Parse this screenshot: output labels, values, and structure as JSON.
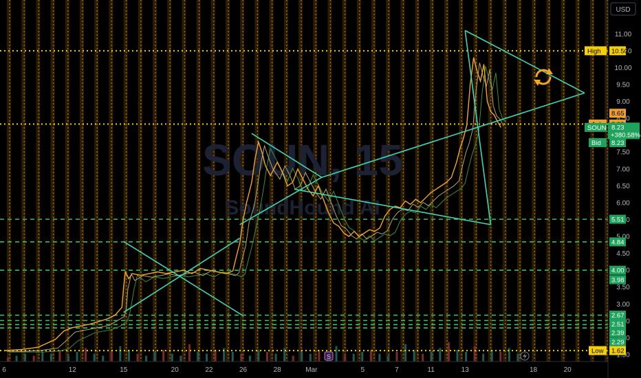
{
  "chart_data": {
    "type": "line",
    "title": "",
    "watermark": {
      "symbol": "SOUN",
      "interval": "15",
      "company": "SoundHound AI"
    },
    "currency": "USD",
    "ylim": [
      1.5,
      11.8
    ],
    "y_ticks": [
      1.5,
      2.0,
      2.5,
      3.0,
      3.5,
      4.0,
      4.5,
      5.0,
      5.5,
      6.0,
      6.5,
      7.0,
      7.5,
      8.0,
      8.5,
      9.0,
      9.5,
      10.0,
      10.5,
      11.0
    ],
    "x_ticks": [
      {
        "label": "6",
        "pos": 0
      },
      {
        "label": "12",
        "pos": 4
      },
      {
        "label": "15",
        "pos": 7
      },
      {
        "label": "20",
        "pos": 10
      },
      {
        "label": "22",
        "pos": 12
      },
      {
        "label": "26",
        "pos": 14
      },
      {
        "label": "28",
        "pos": 16
      },
      {
        "label": "Mar",
        "pos": 18
      },
      {
        "label": "5",
        "pos": 21
      },
      {
        "label": "7",
        "pos": 23
      },
      {
        "label": "11",
        "pos": 25
      },
      {
        "label": "13",
        "pos": 27
      },
      {
        "label": "18",
        "pos": 31
      },
      {
        "label": "20",
        "pos": 33
      }
    ],
    "xlim": [
      0,
      34
    ],
    "series": [
      {
        "name": "SOUN",
        "color": "#f5a623",
        "x": [
          0,
          1,
          2,
          3,
          3.5,
          4,
          5,
          6,
          6.5,
          6.9,
          7,
          7.1,
          7.3,
          7.5,
          8,
          8.5,
          9,
          9.5,
          10,
          10.5,
          11,
          11.5,
          12,
          12.5,
          13,
          13.4,
          13.6,
          13.8,
          14,
          14.2,
          14.5,
          14.7,
          14.9,
          15.1,
          15.3,
          15.6,
          16,
          16.3,
          16.6,
          16.9,
          17.2,
          17.5,
          17.8,
          18.1,
          18.4,
          18.7,
          19,
          19.3,
          19.6,
          19.9,
          20.2,
          20.5,
          20.8,
          21.1,
          21.4,
          21.7,
          22,
          22.3,
          22.6,
          22.9,
          23.2,
          23.5,
          23.8,
          24.1,
          24.4,
          24.7,
          25,
          25.3,
          25.6,
          25.9,
          26.2,
          26.5,
          26.7,
          26.9,
          27.1,
          27.3,
          27.5,
          27.7,
          27.9,
          28.1,
          28.3,
          28.5,
          28.7,
          28.9,
          29.1
        ],
        "y": [
          1.62,
          1.65,
          1.72,
          1.95,
          2.2,
          2.3,
          2.4,
          2.55,
          2.67,
          2.9,
          3.5,
          3.95,
          3.75,
          3.9,
          3.85,
          3.9,
          3.95,
          3.9,
          3.95,
          4.0,
          3.9,
          4.05,
          4.0,
          3.95,
          3.9,
          3.98,
          4.4,
          4.8,
          5.5,
          6.0,
          6.6,
          7.3,
          7.8,
          7.5,
          7.1,
          6.8,
          7.2,
          6.9,
          6.5,
          6.6,
          7.0,
          6.7,
          6.4,
          6.2,
          6.5,
          6.1,
          5.7,
          5.4,
          5.3,
          5.1,
          5.0,
          5.15,
          5.0,
          5.1,
          5.2,
          5.15,
          5.25,
          5.6,
          5.8,
          5.9,
          5.85,
          6.05,
          5.95,
          6.1,
          6.0,
          6.15,
          6.3,
          6.4,
          6.5,
          6.6,
          6.75,
          7.2,
          7.6,
          7.9,
          8.3,
          9.5,
          10.3,
          9.9,
          9.6,
          10.1,
          9.0,
          8.7,
          8.6,
          8.4,
          8.23
        ]
      }
    ],
    "trend_lines": [
      {
        "x1": 7.0,
        "y1": 2.75,
        "x2": 13.8,
        "y2": 4.95
      },
      {
        "x1": 7.0,
        "y1": 4.85,
        "x2": 14.0,
        "y2": 2.65
      },
      {
        "x1": 13.8,
        "y1": 5.35,
        "x2": 18.6,
        "y2": 6.75
      },
      {
        "x1": 14.5,
        "y1": 8.05,
        "x2": 18.6,
        "y2": 6.75
      },
      {
        "x1": 18.6,
        "y1": 6.75,
        "x2": 34.0,
        "y2": 9.25
      },
      {
        "x1": 17.0,
        "y1": 6.4,
        "x2": 28.5,
        "y2": 5.35
      },
      {
        "x1": 28.5,
        "y1": 5.35,
        "x2": 27.0,
        "y2": 11.1
      },
      {
        "x1": 27.0,
        "y1": 11.1,
        "x2": 34.0,
        "y2": 9.25
      }
    ],
    "yellow_levels": [
      10.5,
      8.33,
      1.62
    ],
    "green_levels": [
      5.51,
      4.84,
      4.0,
      2.67,
      2.51,
      2.39,
      2.29
    ],
    "price_labels": [
      {
        "text": "High",
        "value": "10.50",
        "y": 10.5,
        "kind": "yellow"
      },
      {
        "text": "",
        "value": "8.65",
        "y": 8.65,
        "kind": "orange"
      },
      {
        "text": "Ask",
        "value": "8.33",
        "y": 8.33,
        "kind": "orange"
      },
      {
        "text": "SOUN",
        "value": "8.23",
        "y": 8.23,
        "kind": "green",
        "change": "+380.58%"
      },
      {
        "text": "Bid",
        "value": "8.23",
        "y": 7.78,
        "kind": "green"
      },
      {
        "text": "",
        "value": "5.51",
        "y": 5.51,
        "kind": "green"
      },
      {
        "text": "",
        "value": "4.84",
        "y": 4.84,
        "kind": "green"
      },
      {
        "text": "",
        "value": "4.00",
        "y": 4.0,
        "kind": "green"
      },
      {
        "text": "",
        "value": "3.98",
        "y": 3.72,
        "kind": "green"
      },
      {
        "text": "",
        "value": "2.67",
        "y": 2.67,
        "kind": "green"
      },
      {
        "text": "",
        "value": "2.51",
        "y": 2.41,
        "kind": "green"
      },
      {
        "text": "",
        "value": "2.39",
        "y": 2.15,
        "kind": "green"
      },
      {
        "text": "",
        "value": "2.29",
        "y": 1.88,
        "kind": "green"
      },
      {
        "text": "Low",
        "value": "1.62",
        "y": 1.62,
        "kind": "yellow"
      }
    ],
    "volume": [
      0.2,
      0.3,
      0.4,
      0.3,
      0.5,
      0.4,
      0.6,
      0.3,
      0.5,
      0.7,
      0.4,
      0.3,
      0.5,
      0.8,
      0.6,
      0.4,
      0.3,
      0.5,
      0.6,
      0.4,
      0.3,
      0.9,
      0.5,
      0.4,
      0.6,
      0.7,
      0.5,
      0.4,
      0.3,
      0.6,
      0.5,
      0.4,
      0.7,
      0.3,
      0.5,
      0.4,
      0.6,
      0.5,
      0.8,
      0.3,
      0.4,
      0.5,
      0.6,
      0.4,
      0.3,
      0.5,
      0.9,
      0.6,
      0.4,
      0.5,
      0.7,
      1.0,
      0.6,
      0.5,
      0.8,
      0.4,
      0.6,
      0.5,
      0.7,
      0.4
    ],
    "grid": true
  }
}
